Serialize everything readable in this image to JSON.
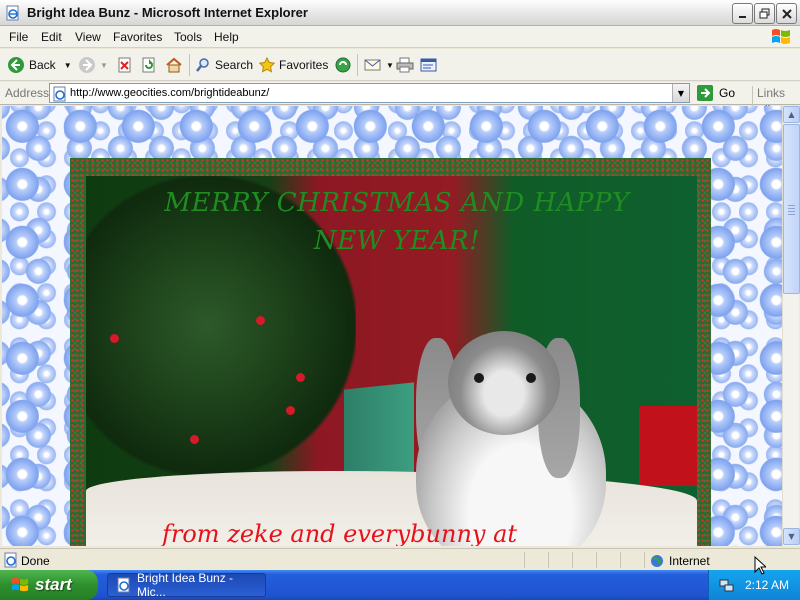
{
  "window": {
    "title": "Bright Idea Bunz - Microsoft Internet Explorer"
  },
  "menu": [
    "File",
    "Edit",
    "View",
    "Favorites",
    "Tools",
    "Help"
  ],
  "toolbar": {
    "back_label": "Back",
    "search_label": "Search",
    "favorites_label": "Favorites"
  },
  "address": {
    "label": "Address",
    "url": "http://www.geocities.com/brightideabunz/",
    "go_label": "Go",
    "links_label": "Links"
  },
  "page": {
    "greeting_line1": "MERRY CHRISTMAS AND HAPPY",
    "greeting_line2": "NEW YEAR!",
    "from_line": "from zeke and everybunny at"
  },
  "status": {
    "text": "Done",
    "zone": "Internet"
  },
  "taskbar": {
    "start_label": "start",
    "task_label": "Bright Idea Bunz - Mic...",
    "clock": "2:12 AM"
  },
  "colors": {
    "greeting": "#1f8d22",
    "from_line": "#e8111a",
    "taskbar": "#245edb",
    "start": "#2c8f2c"
  }
}
